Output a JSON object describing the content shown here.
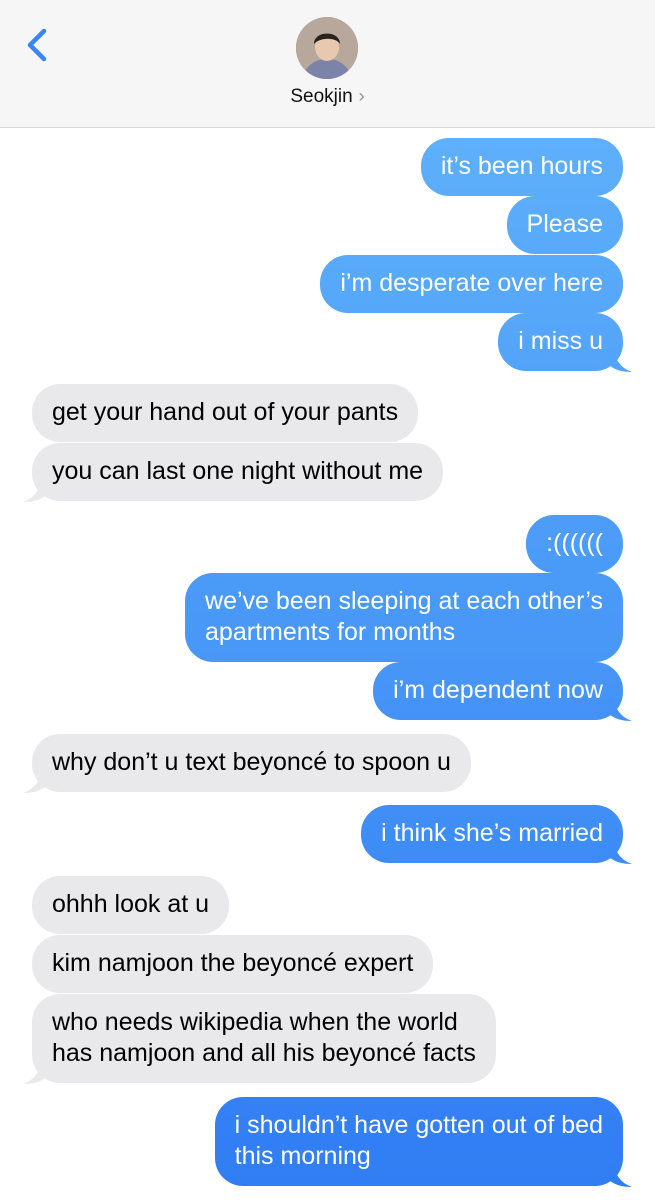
{
  "header": {
    "contact_name": "Seokjin",
    "chevron": "›"
  },
  "icons": {
    "back": "chevron-left-icon",
    "avatar": "contact-avatar"
  },
  "colors": {
    "accent": "#3a86f5",
    "outgoing_top": "#5eb0fb",
    "outgoing_bottom": "#2f7bf3",
    "incoming": "#e9e9eb",
    "header_bg": "#f6f6f6"
  },
  "messages": [
    {
      "dir": "out",
      "text": "it’s been hours"
    },
    {
      "dir": "out",
      "text": "Please"
    },
    {
      "dir": "out",
      "text": "i’m desperate over here"
    },
    {
      "dir": "out",
      "text": "i miss u"
    },
    {
      "dir": "in",
      "text": "get your hand out of your pants"
    },
    {
      "dir": "in",
      "text": "you can last one night without me"
    },
    {
      "dir": "out",
      "text": ":(((((("
    },
    {
      "dir": "out",
      "text": "we’ve been sleeping at each other’s\napartments for months"
    },
    {
      "dir": "out",
      "text": "i’m dependent now"
    },
    {
      "dir": "in",
      "text": "why don’t u text beyoncé to spoon u"
    },
    {
      "dir": "out",
      "text": "i think she’s married"
    },
    {
      "dir": "in",
      "text": "ohhh look at u"
    },
    {
      "dir": "in",
      "text": "kim namjoon the beyoncé expert"
    },
    {
      "dir": "in",
      "text": "who needs wikipedia when the world\nhas namjoon and all his beyoncé facts"
    },
    {
      "dir": "out",
      "text": "i shouldn’t have gotten out of bed\nthis morning"
    }
  ]
}
